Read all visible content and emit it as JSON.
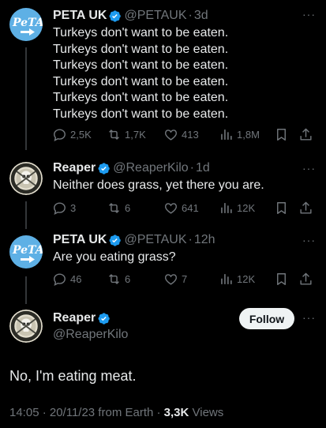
{
  "tweets": [
    {
      "name": "PETA UK",
      "handle": "@PETAUK",
      "time": "3d",
      "avatar_text": "PeTA",
      "lines": [
        "Turkeys don't want to be eaten.",
        "Turkeys don't want to be eaten.",
        "Turkeys don't want to be eaten.",
        "Turkeys don't want to be eaten.",
        "Turkeys don't want to be eaten.",
        "Turkeys don't want to be eaten."
      ],
      "replies": "2,5K",
      "retweets": "1,7K",
      "likes": "413",
      "views": "1,8M"
    },
    {
      "name": "Reaper",
      "handle": "@ReaperKilo",
      "time": "1d",
      "lines": [
        "Neither does grass, yet there you are."
      ],
      "replies": "3",
      "retweets": "6",
      "likes": "641",
      "views": "12K"
    },
    {
      "name": "PETA UK",
      "handle": "@PETAUK",
      "time": "12h",
      "avatar_text": "PeTA",
      "lines": [
        "Are you eating grass?"
      ],
      "replies": "46",
      "retweets": "6",
      "likes": "7",
      "views": "12K"
    }
  ],
  "main": {
    "name": "Reaper",
    "handle": "@ReaperKilo",
    "follow_label": "Follow",
    "text": "No, I'm eating meat.",
    "meta_prefix": "14:05 · 20/11/23 from Earth · ",
    "views_count": "3,3K",
    "views_label": " Views"
  },
  "separator": "·",
  "colors": {
    "background": "#000000",
    "text": "#e7e9ea",
    "muted": "#71767b",
    "verified": "#1d9bf0",
    "peta_blue": "#5eb0e5"
  }
}
